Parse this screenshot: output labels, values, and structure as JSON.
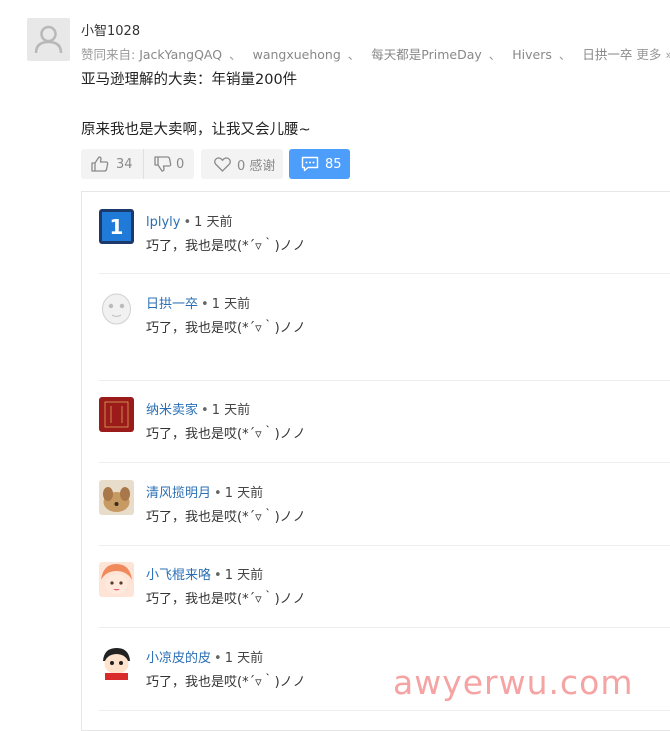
{
  "answer": {
    "author": "小智1028",
    "endorse_prefix": "赞同来自:",
    "endorsers": [
      "JackYangQAQ",
      "wangxuehong",
      "每天都是PrimeDay",
      "Hivers",
      "日拱一卒"
    ],
    "endorse_separator": "、",
    "more_label": "更多 »",
    "lines": [
      "亚马逊理解的大卖：年销量200件",
      "原来我也是大卖啊，让我又会儿腰~"
    ],
    "likes": "34",
    "dislikes": "0",
    "thanks": "0 感谢",
    "comments": "85"
  },
  "comments": [
    {
      "user": "lplyly",
      "time": "1 天前",
      "text": "巧了，我也是哎(*´▿｀)ノノ"
    },
    {
      "user": "日拱一卒",
      "time": "1 天前",
      "text": "巧了，我也是哎(*´▿｀)ノノ"
    },
    {
      "user": "纳米卖家",
      "time": "1 天前",
      "text": "巧了，我也是哎(*´▿｀)ノノ"
    },
    {
      "user": "清风揽明月",
      "time": "1 天前",
      "text": "巧了，我也是哎(*´▿｀)ノノ"
    },
    {
      "user": "小飞棍来咯",
      "time": "1 天前",
      "text": "巧了，我也是哎(*´▿｀)ノノ"
    },
    {
      "user": "小凉皮的皮",
      "time": "1 天前",
      "text": "巧了，我也是哎(*´▿｀)ノノ"
    }
  ],
  "avatar_badge": "1",
  "watermark": "awyerwu.com",
  "colors": {
    "accent": "#4d9dfb",
    "username": "#2a6fb5",
    "watermark": "#f5a3a3"
  }
}
